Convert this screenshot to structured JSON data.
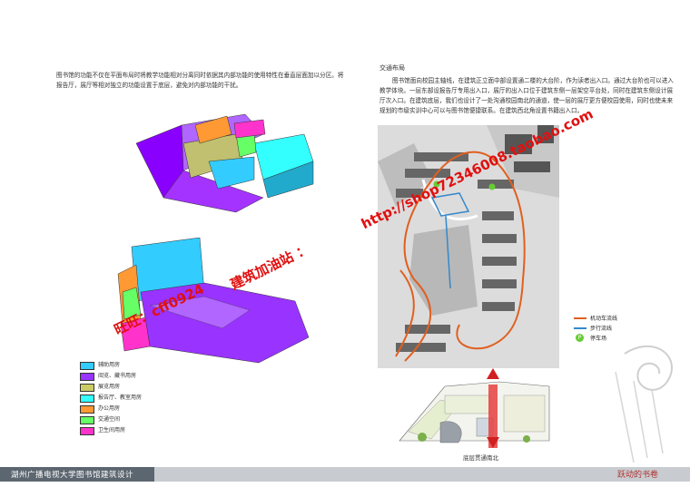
{
  "left_text": {
    "paragraph": "图书馆的功能不仅在平面布局时将教学功能相对分离同时依据其内部功能的使用特性在垂直层面加以分区。将报告厅，展厅等相对独立的功能设置于底层，避免对内部功能的干扰。"
  },
  "legend": [
    {
      "label": "辅助用房",
      "color": "#33ccff"
    },
    {
      "label": "阅览、藏书用房",
      "color": "#9933ff"
    },
    {
      "label": "展览用房",
      "color": "#cccc66"
    },
    {
      "label": "报告厅、教室用房",
      "color": "#33ffff"
    },
    {
      "label": "办公用房",
      "color": "#ff9933"
    },
    {
      "label": "交通空间",
      "color": "#66ff66"
    },
    {
      "label": "卫生间用房",
      "color": "#ff33cc"
    }
  ],
  "right_text": {
    "heading": "交通布局",
    "paragraph": "图书馆面向校园主轴线，在建筑正立面中部设置通二楼的大台阶，作为读者出入口。通过大台阶也可以进入教学体块。一层东部设报告厅专用出入口，展厅的出入口位于建筑东侧一层架空平台处，同时在建筑东侧设计展厅次入口。在建筑底层，我们也设计了一处沟通校园南北的通道，使一层的展厅更方便校园使用，同时也使未来规划的市级实训中心可以与图书馆便捷联系。在建筑西北角设置书籍出入口。"
  },
  "map_legend": [
    {
      "label": "机动车流线",
      "color": "#e06020",
      "kind": "line"
    },
    {
      "label": "步行流线",
      "color": "#3388cc",
      "kind": "line"
    },
    {
      "label": "停车场",
      "color": "#66cc33",
      "kind": "dot",
      "symbol": "P"
    }
  ],
  "floor_plan": {
    "caption": "底层贯通南北"
  },
  "footer": {
    "title": "湖州广播电视大学图书馆建筑设计",
    "brand": "跃动的书卷"
  },
  "watermarks": {
    "diag_top": "http://shop72346008.taobao.com",
    "diag_mid": "建筑加油站 ：",
    "diag_low": "旺旺：cff0924"
  }
}
